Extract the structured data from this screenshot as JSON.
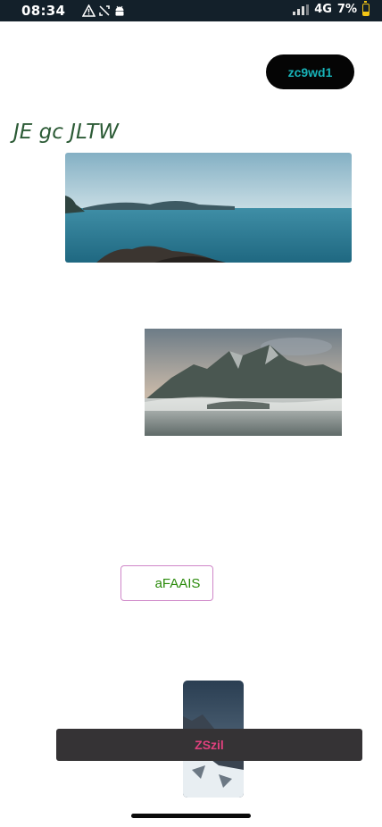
{
  "status_bar": {
    "time": "08:34",
    "left_icons": [
      "warning-icon",
      "no-signal-icon",
      "android-icon"
    ],
    "network": "4G",
    "battery": "7%",
    "battery_level": 0.07,
    "battery_color": "#f3c515"
  },
  "header": {
    "action_button_label": "zc9wd1"
  },
  "page": {
    "title": "JE gc JLTW"
  },
  "images": [
    {
      "name": "lake-photo",
      "subject": "lake with distant hills"
    },
    {
      "name": "mountain-photo",
      "subject": "mountain peaks above fog"
    },
    {
      "name": "snowy-peak-photo",
      "subject": "snowy mountain peak"
    }
  ],
  "outline_button": {
    "label": "aFAAIS"
  },
  "snackbar": {
    "message": "ZSzil"
  },
  "colors": {
    "title": "#2c5b36",
    "top_button_bg": "#050505",
    "top_button_text": "#18b3b8",
    "outline_border": "#cf86c8",
    "outline_text": "#2a8a0a",
    "snackbar_bg": "#353335",
    "snackbar_text": "#e0407d"
  }
}
